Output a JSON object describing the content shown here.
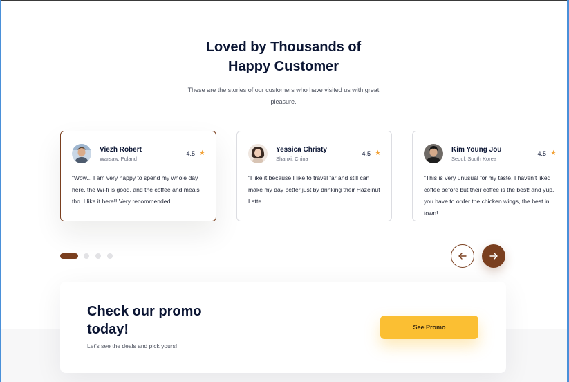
{
  "section": {
    "title_line1": "Loved by Thousands of",
    "title_line2": "Happy Customer",
    "subtitle": "These are the stories of our customers who have visited us with great pleasure."
  },
  "testimonials": [
    {
      "name": "Viezh Robert",
      "location": "Warsaw, Poland",
      "rating": "4.5",
      "quote": "“Wow... I am very happy to spend my whole day here. the Wi-fi is good, and the coffee and meals tho. I like it here!! Very recommended!",
      "active": true
    },
    {
      "name": "Yessica Christy",
      "location": "Shanxi, China",
      "rating": "4.5",
      "quote": "“I like it because I like to travel far and still can make my day better just by drinking their Hazelnut Latte",
      "active": false
    },
    {
      "name": "Kim Young Jou",
      "location": "Seoul, South Korea",
      "rating": "4.5",
      "quote": "“This is very unusual for my taste, I haven’t liked coffee before but their coffee is the best! and yup, you have to order the chicken wings, the best in town!",
      "active": false
    }
  ],
  "icons": {
    "star": "star-icon",
    "prev": "arrow-left-icon",
    "next": "arrow-right-icon"
  },
  "carousel": {
    "page_count": 4,
    "active_index": 0
  },
  "promo": {
    "title_line1": "Check our promo",
    "title_line2": "today!",
    "subtitle": "Let’s see the deals and pick yours!",
    "button_label": "See Promo"
  },
  "colors": {
    "brand_brown": "#7a3f1f",
    "accent_yellow": "#fbbf33",
    "star_orange": "#f2a33a",
    "heading_navy": "#0b1533"
  }
}
